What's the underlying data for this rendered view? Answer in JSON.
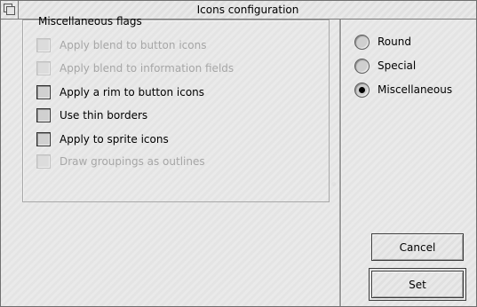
{
  "window": {
    "title": "Icons configuration"
  },
  "left": {
    "group_label": "Miscellaneous flags",
    "options": [
      {
        "label": "Apply blend to button icons",
        "enabled": false,
        "checked": false
      },
      {
        "label": "Apply blend to information fields",
        "enabled": false,
        "checked": false
      },
      {
        "label": "Apply a rim to button icons",
        "enabled": true,
        "checked": false
      },
      {
        "label": "Use thin borders",
        "enabled": true,
        "checked": false
      },
      {
        "label": "Apply to sprite icons",
        "enabled": true,
        "checked": false
      },
      {
        "label": "Draw groupings as outlines",
        "enabled": false,
        "checked": false
      }
    ]
  },
  "right": {
    "radios": [
      {
        "label": "Round",
        "selected": false
      },
      {
        "label": "Special",
        "selected": false
      },
      {
        "label": "Miscellaneous",
        "selected": true
      }
    ],
    "cancel_label": "Cancel",
    "set_label": "Set"
  }
}
